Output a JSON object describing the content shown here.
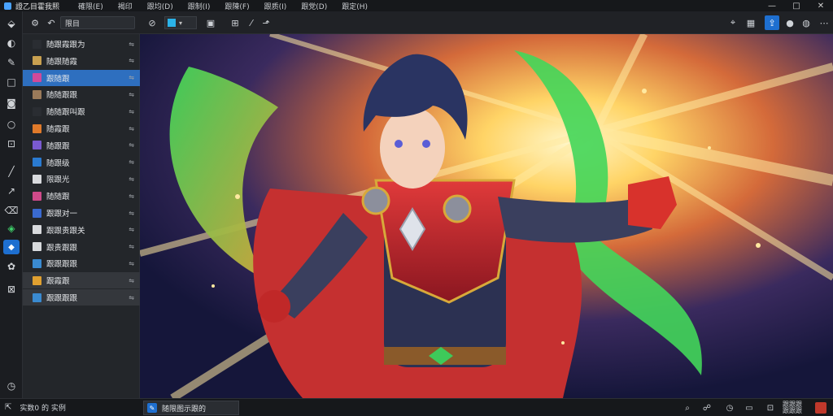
{
  "app": {
    "title": "證乙目霍我熙"
  },
  "menu": [
    {
      "label": "確限(E)"
    },
    {
      "label": "褐印"
    },
    {
      "label": "跟均(D)"
    },
    {
      "label": "跟制(I)"
    },
    {
      "label": "跟陳(F)"
    },
    {
      "label": "跟质(I)"
    },
    {
      "label": "跟党(D)"
    },
    {
      "label": "跟定(H)"
    }
  ],
  "window_controls": {
    "minimize": "—",
    "maximize": "□",
    "close": "✕"
  },
  "toolbar": {
    "search_value": "限目",
    "icons": [
      "settings-icon",
      "back-icon",
      "link-icon",
      "pen-icon",
      "layer-icon",
      "transform-icon",
      "grid-icon",
      "brush-icon",
      "stamp-icon",
      "cursor-icon",
      "pin-icon",
      "upload-icon",
      "share-icon",
      "record-icon",
      "globe-icon",
      "more-icon"
    ]
  },
  "layers": [
    {
      "label": "随跟霞跟为",
      "thumb_color": "#2a2d32"
    },
    {
      "label": "随跟随霞",
      "thumb_color": "#c8a050"
    },
    {
      "label": "跟随跟",
      "thumb_color": "#d04a9a",
      "selected": true
    },
    {
      "label": "随随跟跟",
      "thumb_color": "#9a7a5a"
    },
    {
      "label": "随随跟叫跟",
      "thumb_color": "#2a2d32"
    },
    {
      "label": "随霞跟",
      "thumb_color": "#e07a2a"
    },
    {
      "label": "随跟跟",
      "thumb_color": "#7a5ad0"
    },
    {
      "label": "随跟级",
      "thumb_color": "#2a7ad0"
    },
    {
      "label": "限跟光",
      "thumb_color": "#d8dadd"
    },
    {
      "label": "随随跟",
      "thumb_color": "#d04a8a"
    },
    {
      "label": "跟跟对一",
      "thumb_color": "#3a6ad0"
    },
    {
      "label": "跟跟贵跟关",
      "thumb_color": "#d8dadd"
    },
    {
      "label": "跟贵跟跟",
      "thumb_color": "#d8dadd"
    },
    {
      "label": "跟跟跟跟",
      "thumb_color": "#3a8ad0"
    },
    {
      "label": "跟霞跟",
      "thumb_color": "#e0a030",
      "muted": true
    },
    {
      "label": "跟跟跟跟",
      "thumb_color": "#3a8ad0",
      "muted": true
    }
  ],
  "status": {
    "left_text": "实数0 的 实例",
    "doc_tab": "随限图示跟的",
    "zoom_text_line1": "跟跟跟",
    "zoom_text_line2": "跟跟跟"
  },
  "colors": {
    "accent": "#1e6fd0",
    "panel": "#23262a",
    "selected": "#2e6fbf"
  }
}
